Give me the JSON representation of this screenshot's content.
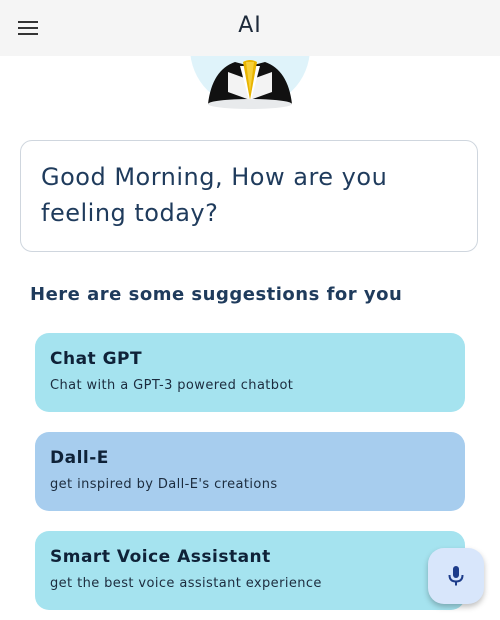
{
  "appbar": {
    "title": "AI",
    "menu_icon": "hamburger-menu-icon"
  },
  "avatar": {
    "icon": "robot-avatar-icon"
  },
  "greeting": {
    "text": "Good Morning, How are you feeling today?"
  },
  "suggestions": {
    "heading": "Here are some suggestions for you",
    "items": [
      {
        "title": "Chat GPT",
        "subtitle": "Chat with a GPT-3 powered chatbot",
        "color": "#a5e3ef"
      },
      {
        "title": "Dall-E",
        "subtitle": "get inspired by Dall-E's creations",
        "color": "#a7cdee"
      },
      {
        "title": "Smart Voice Assistant",
        "subtitle": "get the best voice assistant experience",
        "color": "#a5e3ef"
      }
    ]
  },
  "fab": {
    "icon": "microphone-icon",
    "color": "#d8e6fb",
    "icon_color": "#1d3c8a"
  }
}
